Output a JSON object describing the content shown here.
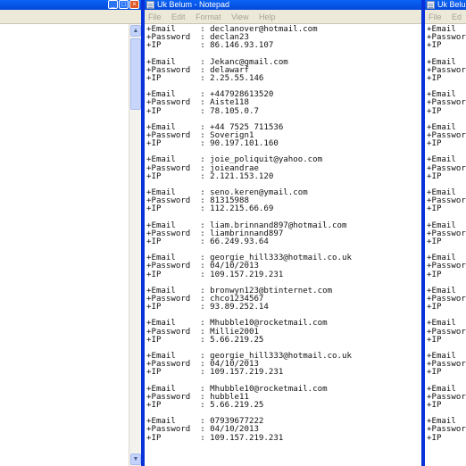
{
  "left_window": {
    "minimize_glyph": "_",
    "maximize_glyph": "□",
    "close_glyph": "×"
  },
  "main_window": {
    "title": "Uk Belum - Notepad",
    "menu": [
      "File",
      "Edit",
      "Format",
      "View",
      "Help"
    ],
    "records": [
      {
        "email": "declanover@hotmail.com",
        "password": "declan23",
        "ip": "86.146.93.107"
      },
      {
        "email": "Jekanc@gmail.com",
        "password": "delawarf",
        "ip": "2.25.55.146"
      },
      {
        "email": "+447928613520",
        "password": "Aiste118",
        "ip": "78.105.0.7"
      },
      {
        "email": "+44 7525 711536",
        "password": "Soverign1",
        "ip": "90.197.101.160"
      },
      {
        "email": "joie_poliquit@yahoo.com",
        "password": "joieandrae",
        "ip": "2.121.153.120"
      },
      {
        "email": "seno.keren@ymail.com",
        "password": "81315988",
        "ip": "112.215.66.69"
      },
      {
        "email": "liam.brinnand897@hotmail.com",
        "password": "liambrinnand897",
        "ip": "66.249.93.64"
      },
      {
        "email": "georgie_hill333@hotmail.co.uk",
        "password": "04/10/2013",
        "ip": "109.157.219.231"
      },
      {
        "email": "bronwyn123@btinternet.com",
        "password": "chco1234567",
        "ip": "93.89.252.14"
      },
      {
        "email": "Mhubble10@rocketmail.com",
        "password": "Millie2001",
        "ip": "5.66.219.25"
      },
      {
        "email": "georgie_hill333@hotmail.co.uk",
        "password": "04/10/2013",
        "ip": "109.157.219.231"
      },
      {
        "email": "Mhubble10@rocketmail.com",
        "password": "hubble11",
        "ip": "5.66.219.25"
      },
      {
        "email": "07939677222",
        "password": "04/10/2013",
        "ip": "109.157.219.231"
      }
    ],
    "labels": {
      "email": "+Email",
      "password": "+Password",
      "ip": "+IP"
    },
    "separator": ":"
  },
  "right_window": {
    "title": "Uk Belum",
    "menu": [
      "File",
      "Ed"
    ],
    "rows": [
      "+Email",
      "+Passwor",
      "+IP",
      "+Email",
      "+Passwor",
      "+IP",
      "+Email",
      "+Passwor",
      "+IP",
      "+Email",
      "+Passwor",
      "+IP",
      "+Email",
      "+Passwor",
      "+IP",
      "+Email",
      "+Passwor",
      "+IP",
      "+Email",
      "+Passwor",
      "+IP",
      "+Email",
      "+Passwor",
      "+IP",
      "+Email",
      "+Passwor",
      "+IP",
      "+Email",
      "+Passwor",
      "+IP",
      "+Email",
      "+Passwor",
      "+IP",
      "+Email",
      "+Passwor",
      "+IP",
      "+Email",
      "+Passwor",
      "+IP"
    ]
  }
}
